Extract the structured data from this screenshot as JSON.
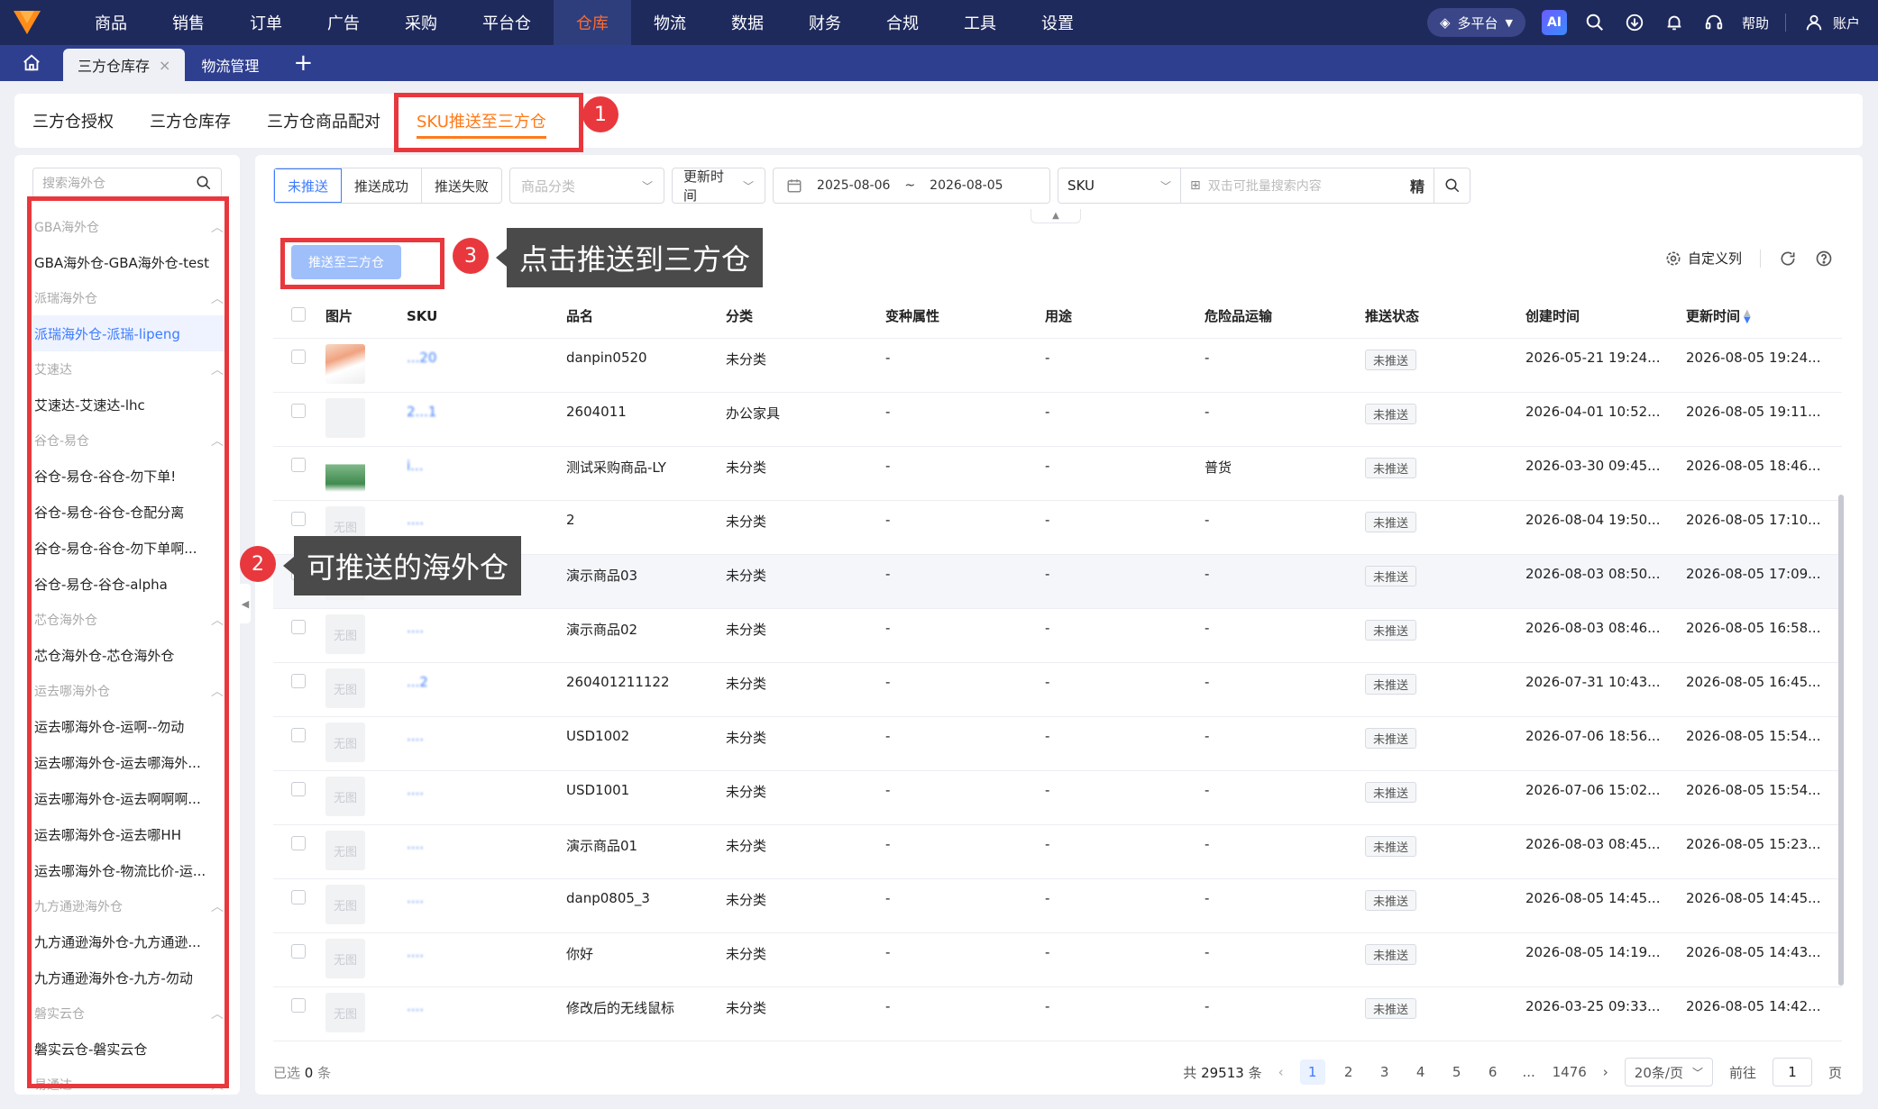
{
  "nav": {
    "items": [
      "商品",
      "销售",
      "订单",
      "广告",
      "采购",
      "平台仓",
      "仓库",
      "物流",
      "数据",
      "财务",
      "合规",
      "工具",
      "设置"
    ],
    "active_index": 6,
    "platform_label": "多平台",
    "ai_label": "AI",
    "help_label": "帮助",
    "account_label": "账户"
  },
  "tabs": {
    "items": [
      {
        "label": "三方仓库存",
        "active": true
      },
      {
        "label": "物流管理",
        "active": false
      }
    ]
  },
  "subtabs": {
    "items": [
      "三方仓授权",
      "三方仓库存",
      "三方仓商品配对",
      "SKU推送至三方仓"
    ],
    "active_index": 3
  },
  "left": {
    "search_placeholder": "搜索海外仓",
    "groups": [
      {
        "name": "GBA海外仓",
        "items": [
          "GBA海外仓-GBA海外仓-test"
        ]
      },
      {
        "name": "派瑞海外仓",
        "items": [
          "派瑞海外仓-派瑞-lipeng"
        ]
      },
      {
        "name": "艾速达",
        "items": [
          "艾速达-艾速达-lhc"
        ]
      },
      {
        "name": "谷仓-易仓",
        "items": [
          "谷仓-易仓-谷仓-勿下单!",
          "谷仓-易仓-谷仓-仓配分离",
          "谷仓-易仓-谷仓-勿下单啊...",
          "谷仓-易仓-谷仓-alpha"
        ]
      },
      {
        "name": "芯仓海外仓",
        "items": [
          "芯仓海外仓-芯仓海外仓"
        ]
      },
      {
        "name": "运去哪海外仓",
        "items": [
          "运去哪海外仓-运啊--勿动",
          "运去哪海外仓-运去哪海外...",
          "运去哪海外仓-运去啊啊啊...",
          "运去哪海外仓-运去哪HH",
          "运去哪海外仓-物流比价-运..."
        ]
      },
      {
        "name": "九方通逊海外仓",
        "items": [
          "九方通逊海外仓-九方通逊...",
          "九方通逊海外仓-九方-勿动"
        ]
      },
      {
        "name": "磐实云仓",
        "items": [
          "磐实云仓-磐实云仓"
        ]
      },
      {
        "name": "易通达",
        "items": []
      }
    ]
  },
  "filters": {
    "status_tabs": [
      "未推送",
      "推送成功",
      "推送失败"
    ],
    "status_active": 0,
    "category_placeholder": "商品分类",
    "time_field": "更新时间",
    "date_start": "2025-08-06",
    "date_sep": "~",
    "date_end": "2026-08-05",
    "search_field": "SKU",
    "search_placeholder": "双击可批量搜索内容",
    "precise_label": "精"
  },
  "actions": {
    "push_button": "推送至三方仓",
    "custom_columns": "自定义列"
  },
  "table": {
    "columns": [
      "图片",
      "SKU",
      "品名",
      "分类",
      "变种属性",
      "用途",
      "危险品运输",
      "推送状态",
      "创建时间",
      "更新时间"
    ],
    "no_image_label": "无图",
    "rows": [
      {
        "img": "photo",
        "sku": "...20",
        "name": "danpin0520",
        "cat": "未分类",
        "var": "-",
        "use": "-",
        "dg": "-",
        "status": "未推送",
        "created": "2026-05-21 19:24...",
        "updated": "2026-08-05 19:24..."
      },
      {
        "img": "photo-light",
        "sku": "2...1",
        "name": "2604011",
        "cat": "办公家具",
        "var": "-",
        "use": "-",
        "dg": "-",
        "status": "未推送",
        "created": "2026-04-01 10:52...",
        "updated": "2026-08-05 19:11..."
      },
      {
        "img": "bottle",
        "sku": "i...",
        "name": "测试采购商品-LY",
        "cat": "未分类",
        "var": "-",
        "use": "-",
        "dg": "普货",
        "status": "未推送",
        "created": "2026-03-30 09:45...",
        "updated": "2026-08-05 18:46..."
      },
      {
        "img": "none",
        "sku": "....",
        "name": "2",
        "cat": "未分类",
        "var": "-",
        "use": "-",
        "dg": "-",
        "status": "未推送",
        "created": "2026-08-04 19:50...",
        "updated": "2026-08-05 17:10..."
      },
      {
        "img": "none",
        "sku": "....",
        "name": "演示商品03",
        "cat": "未分类",
        "var": "-",
        "use": "-",
        "dg": "-",
        "status": "未推送",
        "created": "2026-08-03 08:50...",
        "updated": "2026-08-05 17:09..."
      },
      {
        "img": "none",
        "sku": "....",
        "name": "演示商品02",
        "cat": "未分类",
        "var": "-",
        "use": "-",
        "dg": "-",
        "status": "未推送",
        "created": "2026-08-03 08:46...",
        "updated": "2026-08-05 16:58..."
      },
      {
        "img": "none",
        "sku": "...2",
        "name": "260401211122",
        "cat": "未分类",
        "var": "-",
        "use": "-",
        "dg": "-",
        "status": "未推送",
        "created": "2026-07-31 10:43...",
        "updated": "2026-08-05 16:45..."
      },
      {
        "img": "none",
        "sku": "....",
        "name": "USD1002",
        "cat": "未分类",
        "var": "-",
        "use": "-",
        "dg": "-",
        "status": "未推送",
        "created": "2026-07-06 18:56...",
        "updated": "2026-08-05 15:54..."
      },
      {
        "img": "none",
        "sku": "....",
        "name": "USD1001",
        "cat": "未分类",
        "var": "-",
        "use": "-",
        "dg": "-",
        "status": "未推送",
        "created": "2026-07-06 15:02...",
        "updated": "2026-08-05 15:54..."
      },
      {
        "img": "none",
        "sku": "....",
        "name": "演示商品01",
        "cat": "未分类",
        "var": "-",
        "use": "-",
        "dg": "-",
        "status": "未推送",
        "created": "2026-08-03 08:45...",
        "updated": "2026-08-05 15:23..."
      },
      {
        "img": "none",
        "sku": "....",
        "name": "danp0805_3",
        "cat": "未分类",
        "var": "-",
        "use": "-",
        "dg": "-",
        "status": "未推送",
        "created": "2026-08-05 14:45...",
        "updated": "2026-08-05 14:45..."
      },
      {
        "img": "none",
        "sku": "....",
        "name": "你好",
        "cat": "未分类",
        "var": "-",
        "use": "-",
        "dg": "-",
        "status": "未推送",
        "created": "2026-08-05 14:19...",
        "updated": "2026-08-05 14:43..."
      },
      {
        "img": "none",
        "sku": "....",
        "name": "修改后的无线鼠标",
        "cat": "未分类",
        "var": "-",
        "use": "-",
        "dg": "-",
        "status": "未推送",
        "created": "2026-03-25 09:33...",
        "updated": "2026-08-05 14:42..."
      }
    ]
  },
  "footer": {
    "selected_prefix": "已选",
    "selected_count": "0",
    "selected_suffix": "条",
    "total_prefix": "共",
    "total_count": "29513",
    "total_suffix": "条",
    "pages": [
      "1",
      "2",
      "3",
      "4",
      "5",
      "6",
      "...",
      "1476"
    ],
    "current_page": "1",
    "page_size": "20条/页",
    "goto_prefix": "前往",
    "goto_value": "1",
    "goto_suffix": "页"
  },
  "annotations": {
    "n1": "1",
    "n2": "2",
    "n3": "3",
    "callout2": "可推送的海外仓",
    "callout3": "点击推送到三方仓"
  },
  "colors": {
    "nav_bg": "#1f2a5c",
    "accent": "#ff7a1a",
    "primary": "#3d7bff",
    "highlight": "#e8383d"
  }
}
